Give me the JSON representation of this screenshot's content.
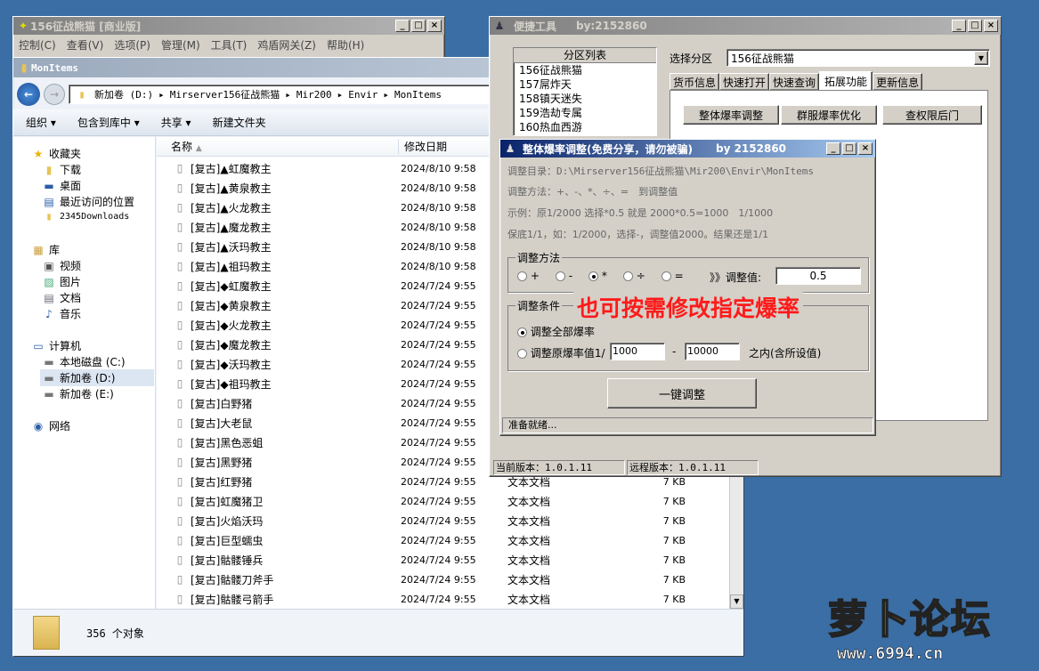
{
  "back_window": {
    "title": "156征战熊猫 [商业版]",
    "menu": [
      "控制(C)",
      "查看(V)",
      "选项(P)",
      "管理(M)",
      "工具(T)",
      "鸡盾网关(Z)",
      "帮助(H)"
    ]
  },
  "explorer": {
    "title": "MonItems",
    "breadcrumb": [
      "新加卷 (D:)",
      "Mirserver156征战熊猫",
      "Mir200",
      "Envir",
      "MonItems"
    ],
    "toolbar": [
      "组织",
      "包含到库中",
      "共享",
      "新建文件夹"
    ],
    "columns": {
      "name": "名称",
      "date": "修改日期"
    },
    "nav": {
      "favorites_label": "收藏夹",
      "favorites": [
        "下载",
        "桌面",
        "最近访问的位置",
        "2345Downloads"
      ],
      "libraries_label": "库",
      "libraries": [
        "视频",
        "图片",
        "文档",
        "音乐"
      ],
      "computer_label": "计算机",
      "drives": [
        "本地磁盘 (C:)",
        "新加卷 (D:)",
        "新加卷 (E:)"
      ],
      "network_label": "网络"
    },
    "files": [
      {
        "name": "[复古]▲虹魔教主",
        "date": "2024/8/10 9:58",
        "type": "",
        "size": ""
      },
      {
        "name": "[复古]▲黄泉教主",
        "date": "2024/8/10 9:58",
        "type": "",
        "size": ""
      },
      {
        "name": "[复古]▲火龙教主",
        "date": "2024/8/10 9:58",
        "type": "",
        "size": ""
      },
      {
        "name": "[复古]▲魔龙教主",
        "date": "2024/8/10 9:58",
        "type": "",
        "size": ""
      },
      {
        "name": "[复古]▲沃玛教主",
        "date": "2024/8/10 9:58",
        "type": "",
        "size": ""
      },
      {
        "name": "[复古]▲祖玛教主",
        "date": "2024/8/10 9:58",
        "type": "",
        "size": ""
      },
      {
        "name": "[复古]◆虹魔教主",
        "date": "2024/7/24 9:55",
        "type": "",
        "size": ""
      },
      {
        "name": "[复古]◆黄泉教主",
        "date": "2024/7/24 9:55",
        "type": "",
        "size": ""
      },
      {
        "name": "[复古]◆火龙教主",
        "date": "2024/7/24 9:55",
        "type": "",
        "size": ""
      },
      {
        "name": "[复古]◆魔龙教主",
        "date": "2024/7/24 9:55",
        "type": "",
        "size": ""
      },
      {
        "name": "[复古]◆沃玛教主",
        "date": "2024/7/24 9:55",
        "type": "",
        "size": ""
      },
      {
        "name": "[复古]◆祖玛教主",
        "date": "2024/7/24 9:55",
        "type": "",
        "size": ""
      },
      {
        "name": "[复古]白野猪",
        "date": "2024/7/24 9:55",
        "type": "",
        "size": ""
      },
      {
        "name": "[复古]大老鼠",
        "date": "2024/7/24 9:55",
        "type": "",
        "size": ""
      },
      {
        "name": "[复古]黑色恶蛆",
        "date": "2024/7/24 9:55",
        "type": "",
        "size": ""
      },
      {
        "name": "[复古]黑野猪",
        "date": "2024/7/24 9:55",
        "type": "",
        "size": ""
      },
      {
        "name": "[复古]红野猪",
        "date": "2024/7/24 9:55",
        "type": "文本文档",
        "size": "7 KB"
      },
      {
        "name": "[复古]虹魔猪卫",
        "date": "2024/7/24 9:55",
        "type": "文本文档",
        "size": "7 KB"
      },
      {
        "name": "[复古]火焰沃玛",
        "date": "2024/7/24 9:55",
        "type": "文本文档",
        "size": "7 KB"
      },
      {
        "name": "[复古]巨型蠕虫",
        "date": "2024/7/24 9:55",
        "type": "文本文档",
        "size": "7 KB"
      },
      {
        "name": "[复古]骷髅锤兵",
        "date": "2024/7/24 9:55",
        "type": "文本文档",
        "size": "7 KB"
      },
      {
        "name": "[复古]骷髅刀斧手",
        "date": "2024/7/24 9:55",
        "type": "文本文档",
        "size": "7 KB"
      },
      {
        "name": "[复古]骷髅弓箭手",
        "date": "2024/7/24 9:55",
        "type": "文本文档",
        "size": "7 KB"
      }
    ],
    "status_count": "356 个对象"
  },
  "quick_tool": {
    "title": "便捷工具",
    "author": "by:2152860",
    "partition_list_header": "分区列表",
    "partitions": [
      "156征战熊猫",
      "157屌炸天",
      "158镇天迷失",
      "159浩劫专属",
      "160热血西游"
    ],
    "select_label": "选择分区",
    "select_value": "156征战熊猫",
    "tabs": [
      "货币信息",
      "快速打开",
      "快速查询",
      "拓展功能",
      "更新信息"
    ],
    "active_tab": "拓展功能",
    "buttons": [
      "整体爆率调整",
      "群服爆率优化",
      "查权限后门"
    ],
    "current_version": "当前版本：1.0.1.11",
    "remote_version": "远程版本：1.0.1.11"
  },
  "drop_dialog": {
    "title": "整体爆率调整(免费分享，请勿被骗)",
    "author": "by 2152860",
    "dir_label": "调整目录：D:\\Mirserver156征战熊猫\\Mir200\\Envir\\MonItems",
    "method_desc": "调整方法：+、-、*、÷、=　到调整值",
    "example": "示例：原1/2000 选择*0.5 就是 2000*0.5=1000　1/1000",
    "floor_note": "保底1/1，如：1/2000，选择-，调整值2000。结果还是1/1",
    "method_group": "调整方法",
    "ops": [
      "+",
      "-",
      "*",
      "÷",
      "="
    ],
    "selected_op": "*",
    "value_label": "》》调整值:",
    "value": "0.5",
    "cond_group": "调整条件",
    "cond_all": "调整全部爆率",
    "cond_range": "调整原爆率值1/",
    "range_from": "1000",
    "range_sep": "-",
    "range_to": "10000",
    "range_suffix": "之内(含所设值)",
    "run_button": "一键调整",
    "status": "准备就绪...",
    "annotation": "也可按需修改指定爆率"
  },
  "watermark": {
    "brand": "萝卜论坛",
    "url": "www.6994.cn"
  },
  "colors": {
    "desktop": "#3a6ea5",
    "annotation": "#ff1a1a",
    "active_title": "#0a246a"
  }
}
